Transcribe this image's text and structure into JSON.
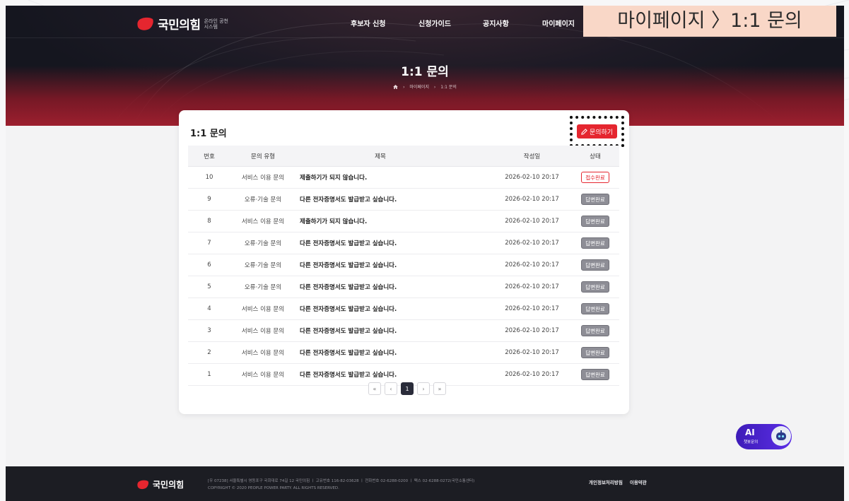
{
  "header": {
    "logo_text": "국민의힘",
    "logo_sub": "온라인 공천시스템",
    "nav": [
      "후보자 신청",
      "신청가이드",
      "공지사항",
      "마이페이지"
    ]
  },
  "breadcrumb_overlay": "마이페이지 〉1:1 문의",
  "hero": {
    "title": "1:1 문의",
    "crumb_1": "마이페이지",
    "crumb_2": "1:1 문의",
    "sep": "›"
  },
  "card": {
    "title": "1:1 문의",
    "ask_button": "문의하기",
    "columns": [
      "번호",
      "문의 유형",
      "제목",
      "작성일",
      "상태"
    ],
    "rows": [
      {
        "no": "10",
        "type": "서비스 이용 문의",
        "title": "제출하기가 되지 않습니다.",
        "date": "2026-02-10 20:17",
        "status": "접수완료",
        "kind": "recv"
      },
      {
        "no": "9",
        "type": "오류·기술 문의",
        "title": "다른 전자증명서도 발급받고 싶습니다.",
        "date": "2026-02-10 20:17",
        "status": "답변완료",
        "kind": "done"
      },
      {
        "no": "8",
        "type": "서비스 이용 문의",
        "title": "제출하기가 되지 않습니다.",
        "date": "2026-02-10 20:17",
        "status": "답변완료",
        "kind": "done"
      },
      {
        "no": "7",
        "type": "오류·기술 문의",
        "title": "다른 전자증명서도 발급받고 싶습니다.",
        "date": "2026-02-10 20:17",
        "status": "답변완료",
        "kind": "done"
      },
      {
        "no": "6",
        "type": "오류·기술 문의",
        "title": "다른 전자증명서도 발급받고 싶습니다.",
        "date": "2026-02-10 20:17",
        "status": "답변완료",
        "kind": "done"
      },
      {
        "no": "5",
        "type": "오류·기술 문의",
        "title": "다른 전자증명서도 발급받고 싶습니다.",
        "date": "2026-02-10 20:17",
        "status": "답변완료",
        "kind": "done"
      },
      {
        "no": "4",
        "type": "서비스 이용 문의",
        "title": "다른 전자증명서도 발급받고 싶습니다.",
        "date": "2026-02-10 20:17",
        "status": "답변완료",
        "kind": "done"
      },
      {
        "no": "3",
        "type": "서비스 이용 문의",
        "title": "다른 전자증명서도 발급받고 싶습니다.",
        "date": "2026-02-10 20:17",
        "status": "답변완료",
        "kind": "done"
      },
      {
        "no": "2",
        "type": "서비스 이용 문의",
        "title": "다른 전자증명서도 발급받고 싶습니다.",
        "date": "2026-02-10 20:17",
        "status": "답변완료",
        "kind": "done"
      },
      {
        "no": "1",
        "type": "서비스 이용 문의",
        "title": "다른 전자증명서도 발급받고 싶습니다.",
        "date": "2026-02-10 20:17",
        "status": "답변완료",
        "kind": "done"
      }
    ]
  },
  "pagination": {
    "first": "«",
    "prev": "‹",
    "current": "1",
    "next": "›",
    "last": "»"
  },
  "ai_chat": {
    "label": "AI",
    "sub": "챗봇문의"
  },
  "footer": {
    "logo_text": "국민의힘",
    "info_line1": "[우 07238] 서울특별시 영등포구 국회대로 74길 12 국민의힘 ㅣ 고유번호 116-82-03628 ㅣ 전화번호 02-6288-0200 ㅣ 팩스 02-6288-0272(국민소통센터)",
    "info_line2": "COPYRIGHT © 2020 PEOPLE POWER PARTY. ALL RIGHTS RESERVED.",
    "links": [
      "개인정보처리방침",
      "이용약관"
    ]
  },
  "colors": {
    "accent": "#e5262f",
    "done_badge": "#8e8e96",
    "footer": "#1c1d23"
  }
}
